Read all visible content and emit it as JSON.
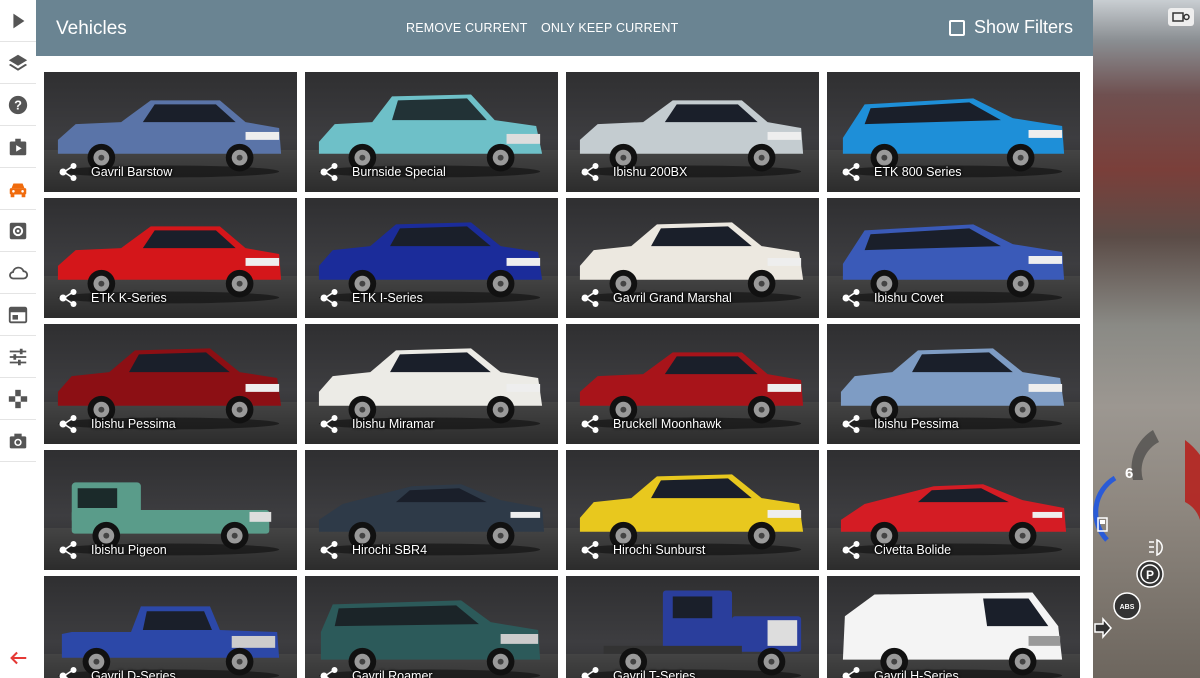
{
  "header": {
    "title": "Vehicles",
    "remove_current": "REMOVE CURRENT",
    "only_keep_current": "ONLY KEEP CURRENT",
    "show_filters": "Show Filters",
    "show_filters_checked": false
  },
  "sidebar": {
    "items": [
      {
        "icon": "play-icon"
      },
      {
        "icon": "layers-icon"
      },
      {
        "icon": "help-icon"
      },
      {
        "icon": "scenario-icon"
      },
      {
        "icon": "car-icon",
        "active": true
      },
      {
        "icon": "settings-icon"
      },
      {
        "icon": "cloud-icon"
      },
      {
        "icon": "window-icon"
      },
      {
        "icon": "sliders-icon"
      },
      {
        "icon": "gamepad-icon"
      },
      {
        "icon": "camera-icon"
      }
    ],
    "back_icon": "back-arrow-icon"
  },
  "vehicles": [
    {
      "name": "Gavril Barstow",
      "color": "#5a74a8",
      "shape": "coupe"
    },
    {
      "name": "Burnside Special",
      "color": "#6ec0c8",
      "shape": "classic"
    },
    {
      "name": "Ibishu 200BX",
      "color": "#c4ccd0",
      "shape": "coupe"
    },
    {
      "name": "ETK 800 Series",
      "color": "#1e8fd8",
      "shape": "hatch"
    },
    {
      "name": "ETK K-Series",
      "color": "#d4161a",
      "shape": "coupe"
    },
    {
      "name": "ETK I-Series",
      "color": "#1b2c9a",
      "shape": "sedan"
    },
    {
      "name": "Gavril Grand Marshal",
      "color": "#ece8e0",
      "shape": "sedan"
    },
    {
      "name": "Ibishu Covet",
      "color": "#3a5ab8",
      "shape": "hatch"
    },
    {
      "name": "Ibishu Pessima",
      "color": "#8c0f14",
      "shape": "sedan"
    },
    {
      "name": "Ibishu Miramar",
      "color": "#ecebe6",
      "shape": "sedan"
    },
    {
      "name": "Bruckell Moonhawk",
      "color": "#a8141a",
      "shape": "coupe"
    },
    {
      "name": "Ibishu Pessima",
      "color": "#7e9cc4",
      "shape": "sedan"
    },
    {
      "name": "Ibishu Pigeon",
      "color": "#5a9c8a",
      "shape": "truck"
    },
    {
      "name": "Hirochi SBR4",
      "color": "#2e3a48",
      "shape": "sports"
    },
    {
      "name": "Hirochi Sunburst",
      "color": "#e8c81e",
      "shape": "sedan"
    },
    {
      "name": "Civetta Bolide",
      "color": "#d41c24",
      "shape": "sports"
    },
    {
      "name": "Gavril D-Series",
      "color": "#2c48a8",
      "shape": "pickup"
    },
    {
      "name": "Gavril Roamer",
      "color": "#2c5a5a",
      "shape": "suv"
    },
    {
      "name": "Gavril T-Series",
      "color": "#2a3e9c",
      "shape": "semi"
    },
    {
      "name": "Gavril H-Series",
      "color": "#f4f4f4",
      "shape": "van"
    }
  ],
  "hud": {
    "gear": "6",
    "parking_label": "P",
    "abs_label": "ABS",
    "accent": "#c62828",
    "fuel_color": "#2a5bd7"
  }
}
